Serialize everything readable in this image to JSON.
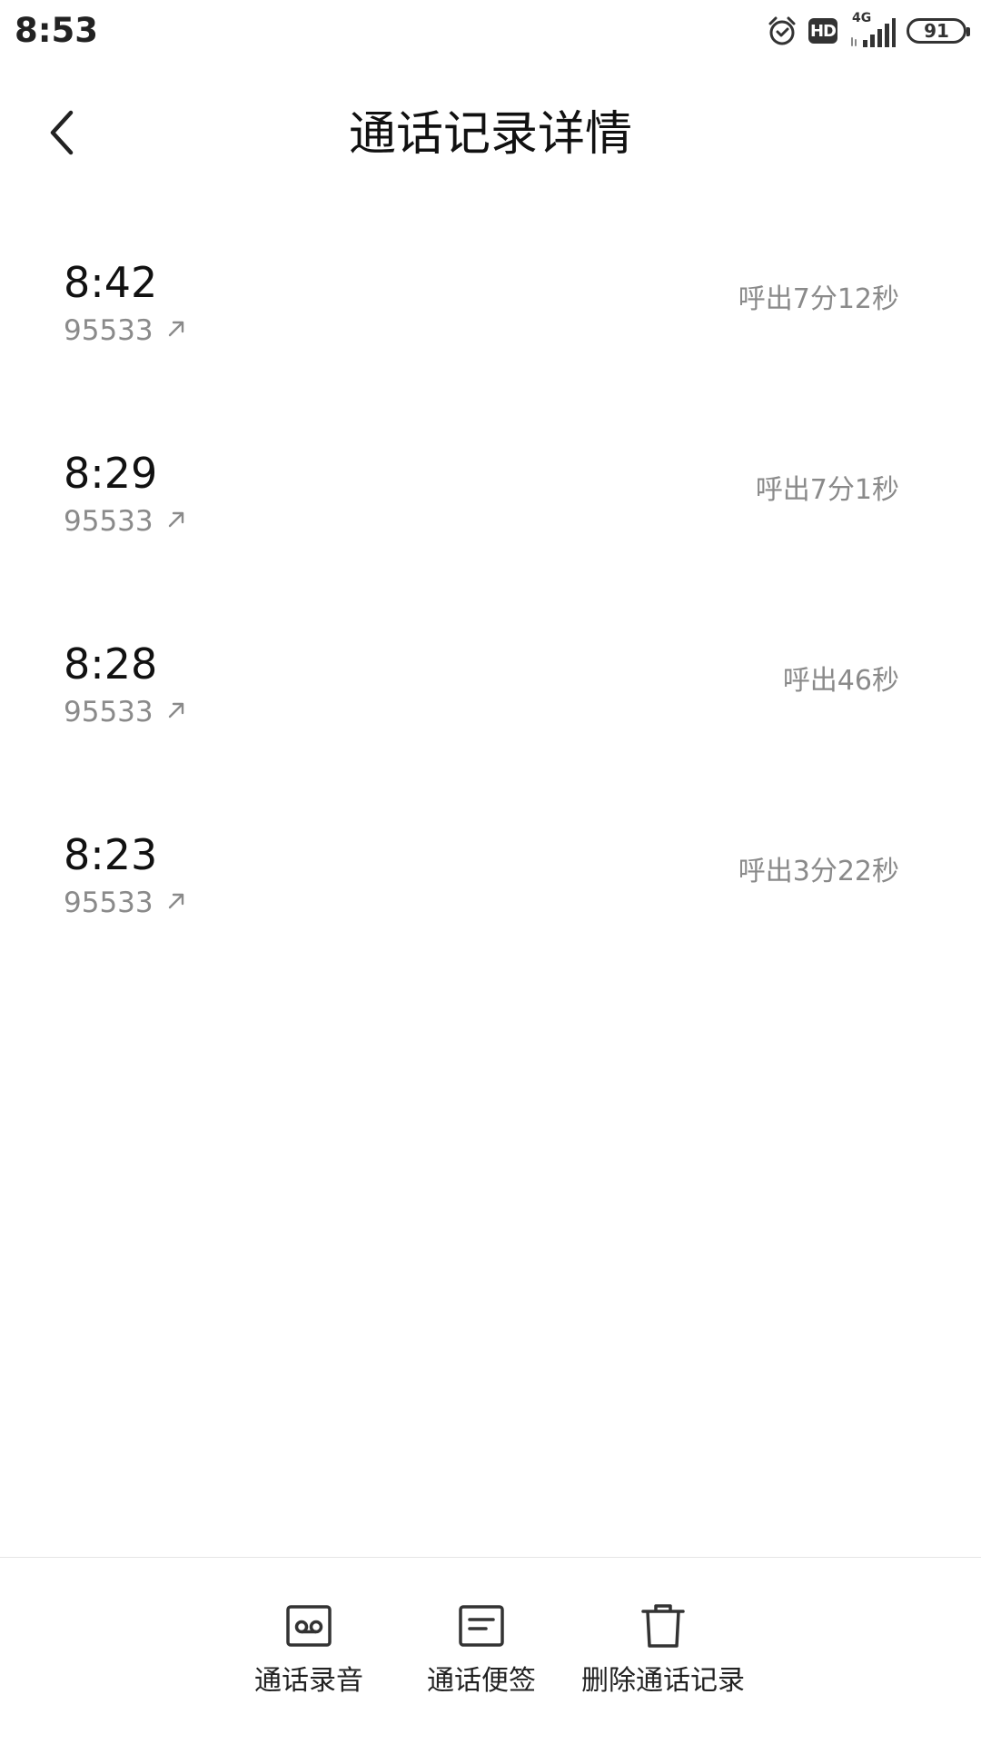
{
  "status_bar": {
    "time": "8:53",
    "network": "4G",
    "hd_label": "HD",
    "battery": "91",
    "icons": [
      "alarm-icon",
      "hd-icon",
      "signal-icon",
      "battery-icon"
    ]
  },
  "header": {
    "title": "通话记录详情",
    "back_icon": "chevron-left-icon"
  },
  "calls": [
    {
      "time": "8:42",
      "number": "95533",
      "direction_icon": "outgoing-arrow-icon",
      "duration": "呼出7分12秒"
    },
    {
      "time": "8:29",
      "number": "95533",
      "direction_icon": "outgoing-arrow-icon",
      "duration": "呼出7分1秒"
    },
    {
      "time": "8:28",
      "number": "95533",
      "direction_icon": "outgoing-arrow-icon",
      "duration": "呼出46秒"
    },
    {
      "time": "8:23",
      "number": "95533",
      "direction_icon": "outgoing-arrow-icon",
      "duration": "呼出3分22秒"
    }
  ],
  "bottom_actions": [
    {
      "label": "通话录音",
      "icon": "voicemail-icon"
    },
    {
      "label": "通话便签",
      "icon": "note-icon"
    },
    {
      "label": "删除通话记录",
      "icon": "trash-icon"
    }
  ],
  "colors": {
    "primary_text": "#111111",
    "secondary_text": "#8a8a8a",
    "background": "#ffffff",
    "divider": "#e6e6e6"
  }
}
